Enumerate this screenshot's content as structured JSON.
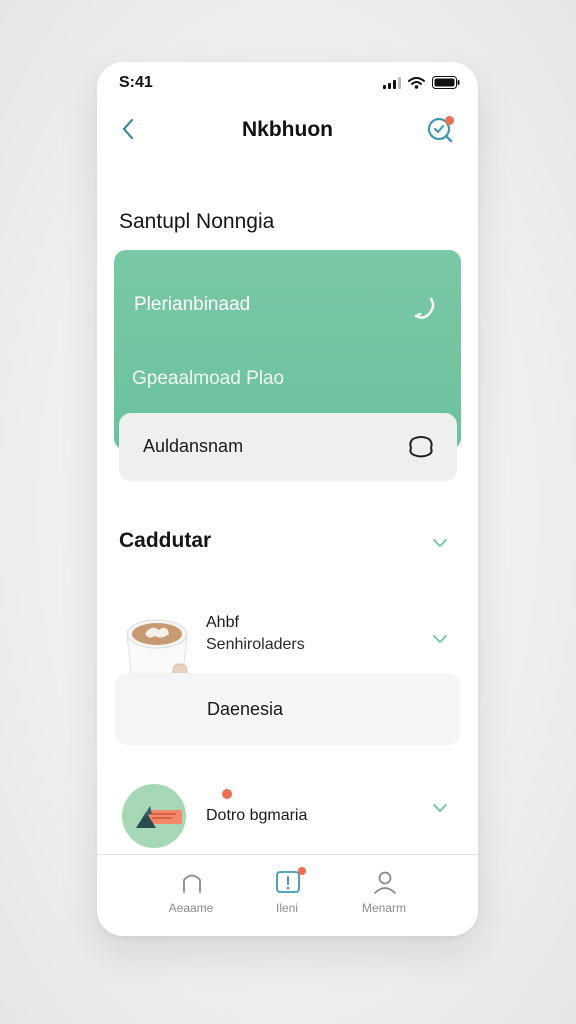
{
  "status": {
    "time": "S:41"
  },
  "nav": {
    "title": "Nkbhuon"
  },
  "section1": {
    "title": "Santupl Nonngia"
  },
  "green_card": {
    "row1": "Plerianbinaad",
    "row2": "Gpeaalmoad Plao"
  },
  "gray_card": {
    "label": "Auldansnam"
  },
  "section2": {
    "title": "Caddutar"
  },
  "item1": {
    "title": "Ahbf",
    "subtitle": "Senhiroladers",
    "card_label": "Daenesia"
  },
  "item2": {
    "title": "Dotro bgmaria"
  },
  "tabs": [
    {
      "label": "Aeaame"
    },
    {
      "label": "Ileni"
    },
    {
      "label": "Menarm"
    }
  ],
  "colors": {
    "accent": "#3d9ab0",
    "green_card": "#72c5a2",
    "badge": "#ee6e50"
  }
}
